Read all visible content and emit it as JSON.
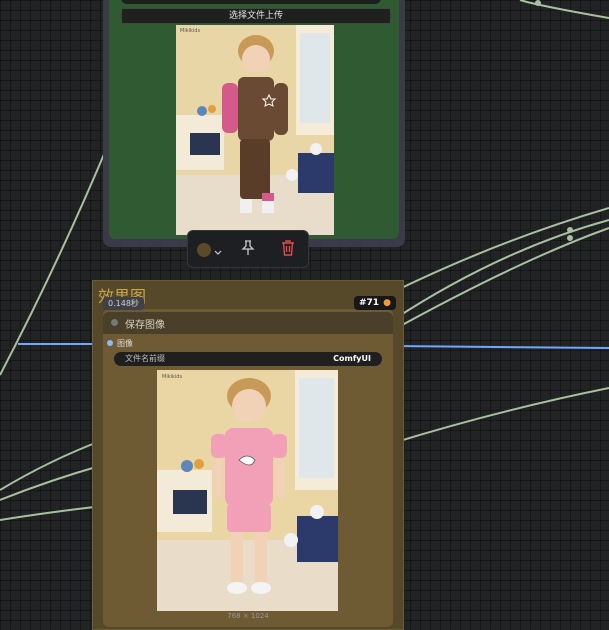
{
  "colors": {
    "canvas_bg": "#222324",
    "load_node_bg": "#2f5a32",
    "save_node_bg": "#6e5a33",
    "wire_green": "#a8c0a0",
    "wire_blue": "#6fa8ff",
    "delete_red": "#e0484a",
    "swatch": "#5a4a26"
  },
  "load_node": {
    "upload_button_label": "选择文件上传"
  },
  "toolbar": {
    "color_icon": "color-swatch-icon",
    "chevron_icon": "chevron-down-icon",
    "pin_icon": "pin-icon",
    "delete_icon": "trash-icon"
  },
  "save_node": {
    "title": "效果图",
    "exec_time": "0.148秒",
    "node_id": "#71",
    "header_label": "保存图像",
    "input_label": "图像",
    "prefix_key": "文件名前缀",
    "prefix_value": "ComfyUI",
    "image_dims": "768 × 1024"
  },
  "photos": {
    "load_watermark": "Mikikids",
    "save_watermark": "Mikikids"
  }
}
